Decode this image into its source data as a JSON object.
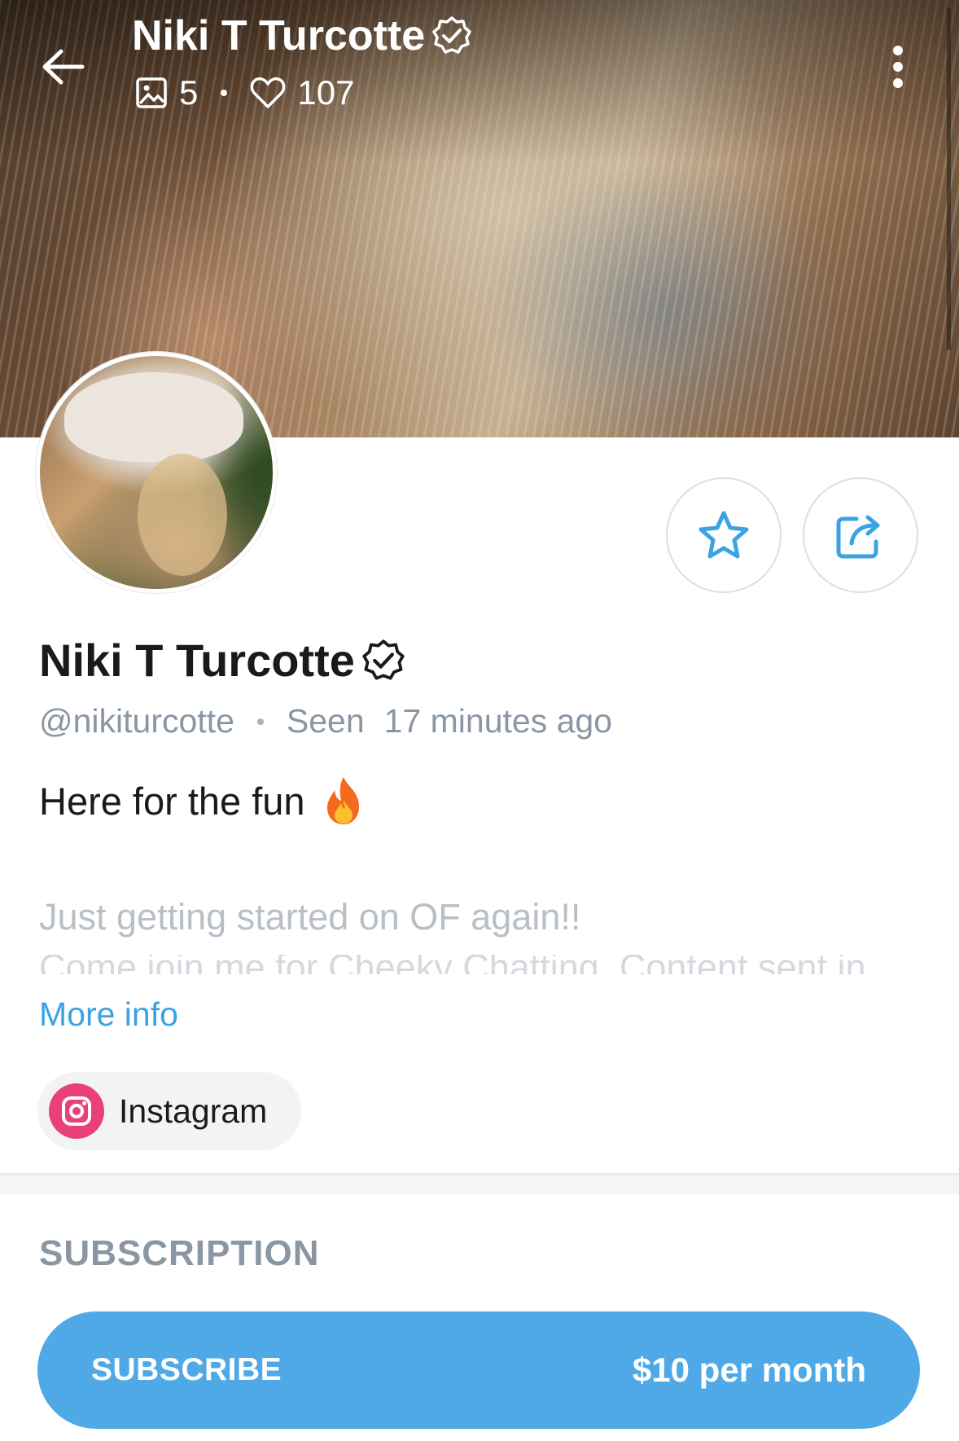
{
  "header": {
    "title": "Niki T Turcotte",
    "media_count": "5",
    "likes_count": "107"
  },
  "profile": {
    "name": "Niki T Turcotte",
    "username": "@nikiturcotte",
    "seen_label": "Seen",
    "seen_time": "17 minutes ago",
    "bio_line1": "Here for the fun",
    "bio_emoji": "fire",
    "bio_line2": "Just getting started on OF again!!",
    "bio_line3": "Come join me for Cheeky Chatting, Content sent in",
    "more_info": "More info",
    "social_link": "Instagram"
  },
  "subscription": {
    "heading": "SUBSCRIPTION",
    "button_label": "SUBSCRIBE",
    "price": "$10 per month"
  },
  "icons": {
    "back": "back-arrow-icon",
    "more": "more-vertical-icon",
    "media": "image-icon",
    "likes": "heart-icon",
    "verified": "verified-badge-icon",
    "favorite": "star-icon",
    "share": "share-icon",
    "instagram": "instagram-icon"
  },
  "colors": {
    "accent": "#4fa9e6",
    "link": "#3aa3e2",
    "muted": "#8a96a3",
    "instagram": "#e9407a"
  }
}
